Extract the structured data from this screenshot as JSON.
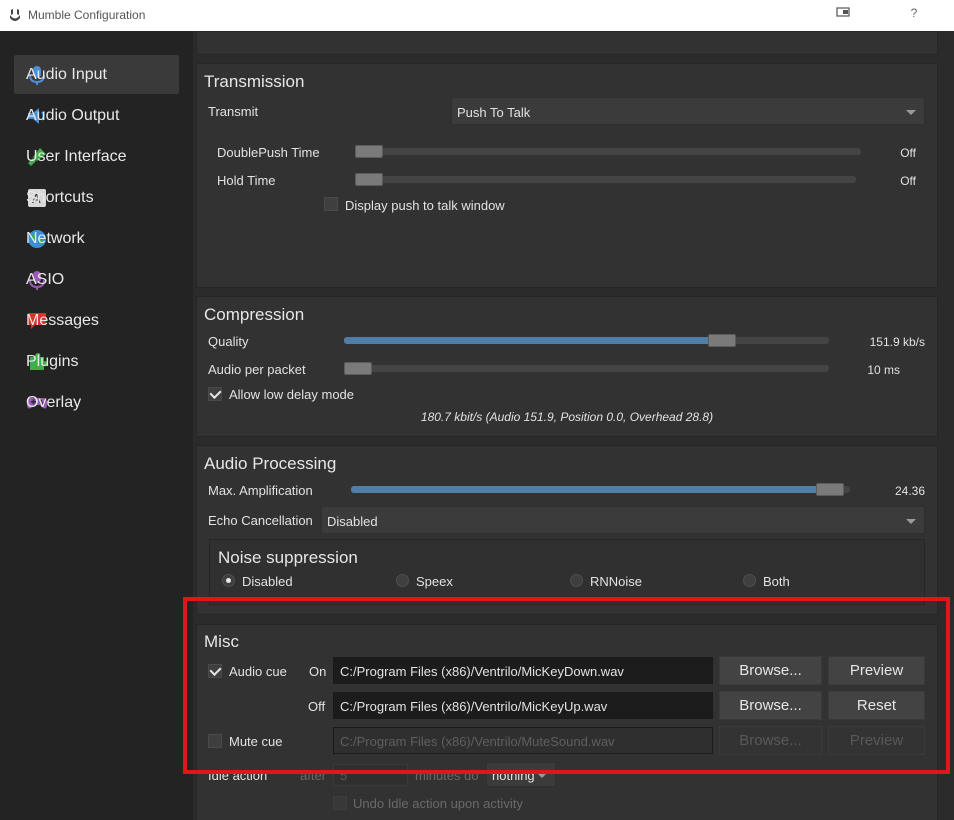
{
  "window": {
    "title": "Mumble Configuration",
    "help": "?"
  },
  "sidebar": {
    "items": [
      {
        "label": "Audio Input",
        "icon": "microphone-icon",
        "active": true
      },
      {
        "label": "Audio Output",
        "icon": "speaker-icon"
      },
      {
        "label": "User Interface",
        "icon": "brush-icon"
      },
      {
        "label": "Shortcuts",
        "icon": "keyboard-key-icon"
      },
      {
        "label": "Network",
        "icon": "globe-icon"
      },
      {
        "label": "ASIO",
        "icon": "asio-microphone-icon"
      },
      {
        "label": "Messages",
        "icon": "speech-bubble-icon"
      },
      {
        "label": "Plugins",
        "icon": "puzzle-icon"
      },
      {
        "label": "Overlay",
        "icon": "gamepad-icon"
      }
    ]
  },
  "transmission": {
    "title": "Transmission",
    "transmit_label": "Transmit",
    "transmit_value": "Push To Talk",
    "doublepush_label": "DoublePush Time",
    "doublepush_value": "Off",
    "hold_label": "Hold Time",
    "hold_value": "Off",
    "ptt_window_label": "Display push to talk window"
  },
  "compression": {
    "title": "Compression",
    "quality_label": "Quality",
    "quality_value": "151.9 kb/s",
    "quality_level": 0.78,
    "packet_label": "Audio per packet",
    "packet_value": "10 ms",
    "low_delay_label": "Allow low delay mode",
    "summary": "180.7 kbit/s (Audio 151.9, Position 0.0, Overhead 28.8)"
  },
  "processing": {
    "title": "Audio Processing",
    "amp_label": "Max. Amplification",
    "amp_value": "24.36",
    "amp_level": 0.96,
    "echo_label": "Echo Cancellation",
    "echo_value": "Disabled",
    "noise_title": "Noise suppression",
    "noise_options": [
      "Disabled",
      "Speex",
      "RNNoise",
      "Both"
    ],
    "noise_selected": "Disabled"
  },
  "misc": {
    "title": "Misc",
    "audio_cue_label": "Audio cue",
    "on_label": "On",
    "on_path": "C:/Program Files (x86)/Ventrilo/MicKeyDown.wav",
    "off_label": "Off",
    "off_path": "C:/Program Files (x86)/Ventrilo/MicKeyUp.wav",
    "browse_label": "Browse...",
    "preview_label": "Preview",
    "reset_label": "Reset",
    "mute_cue_label": "Mute cue",
    "mute_path": "C:/Program Files (x86)/Ventrilo/MuteSound.wav",
    "idle_label": "Idle action",
    "after_label": "after",
    "idle_minutes": "5",
    "minutes_do_label": "minutes do",
    "idle_action_value": "nothing",
    "undo_idle_label": "Undo Idle action upon activity"
  },
  "colors": {
    "accent": "#4f7ea6",
    "highlight": "#e0161b"
  }
}
